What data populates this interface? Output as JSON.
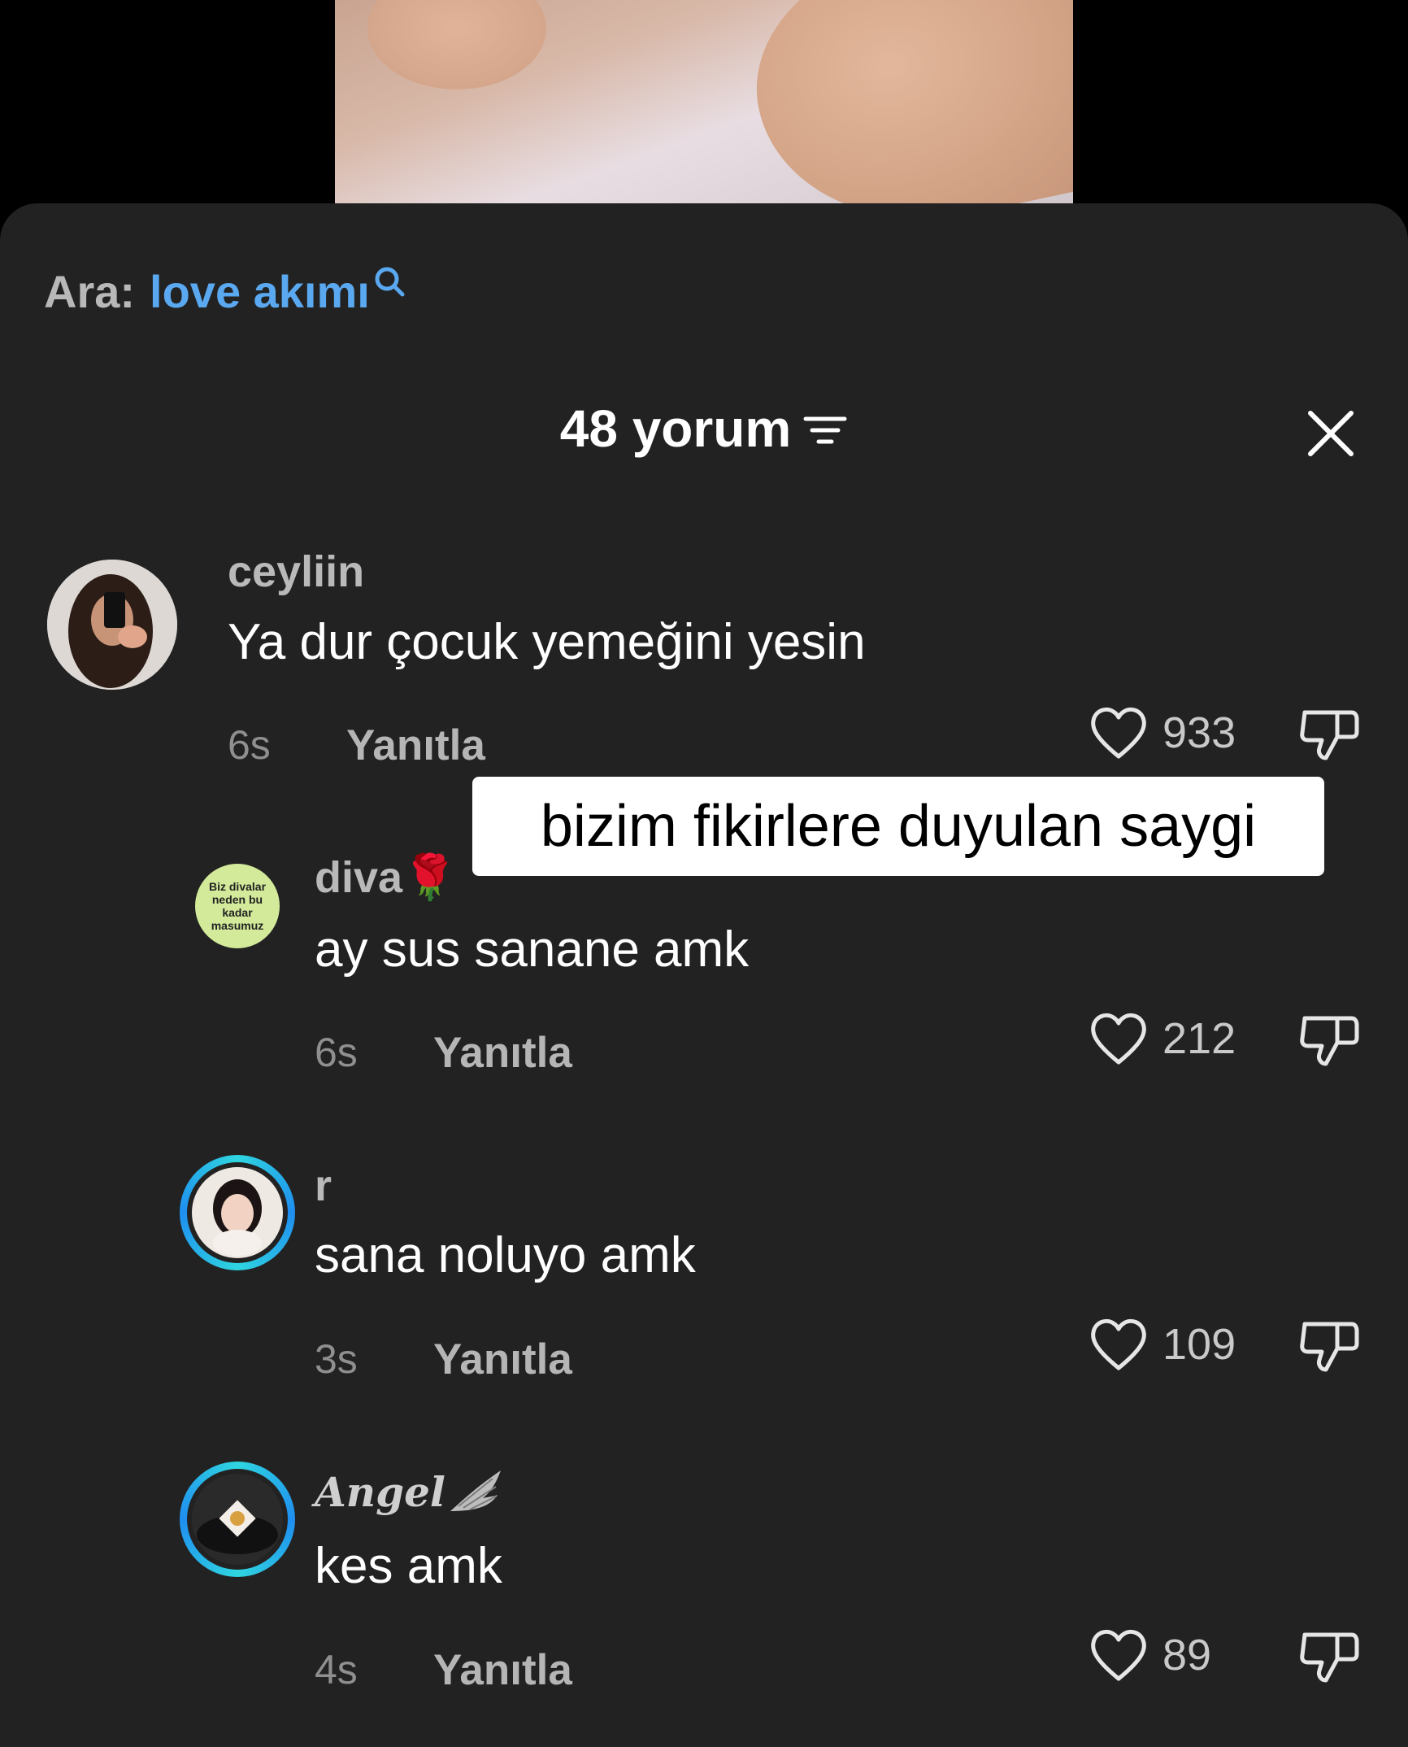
{
  "search": {
    "label": "Ara:",
    "query": "love akımı"
  },
  "header": {
    "title": "48 yorum"
  },
  "overlay": {
    "caption": "bizim fikirlere duyulan saygi"
  },
  "avatar_badge": {
    "line1": "Biz divalar",
    "line2": "neden bu",
    "line3": "kadar",
    "line4": "masumuz"
  },
  "comments": [
    {
      "username": "ceyliin",
      "text": "Ya dur çocuk yemeğini yesin",
      "time": "6s",
      "reply": "Yanıtla",
      "likes": "933"
    },
    {
      "username": "diva🌹",
      "text": "ay sus sanane amk",
      "time": "6s",
      "reply": "Yanıtla",
      "likes": "212"
    },
    {
      "username": "r",
      "text": "sana noluyo amk",
      "time": "3s",
      "reply": "Yanıtla",
      "likes": "109"
    },
    {
      "username": "Angel",
      "text": "kes amk",
      "time": "4s",
      "reply": "Yanıtla",
      "likes": "89"
    }
  ],
  "colors": {
    "accent": "#5aa8f0",
    "sheet": "#222222",
    "ring": "#2bc4e6"
  }
}
